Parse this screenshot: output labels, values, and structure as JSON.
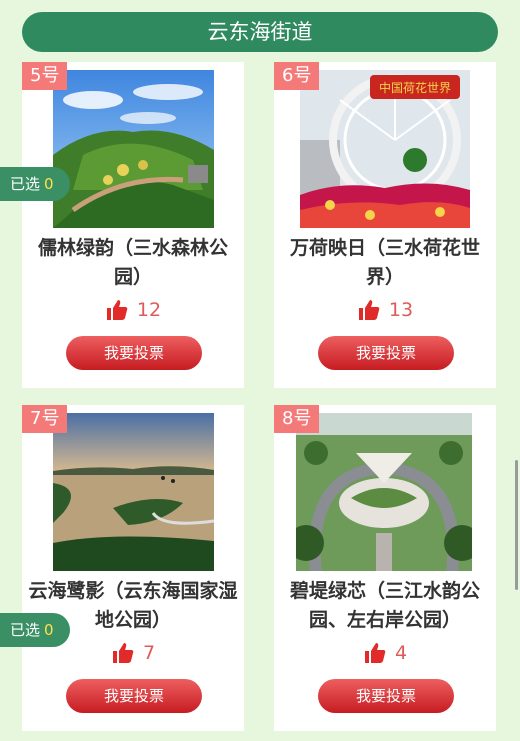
{
  "header": {
    "title": "云东海街道"
  },
  "badge": {
    "label": "已选",
    "count": "0"
  },
  "cards": [
    {
      "tag": "5号",
      "title": "儒林绿韵（三水森林公园）",
      "likes": "12",
      "vote_label": "我要投票"
    },
    {
      "tag": "6号",
      "title": "万荷映日（三水荷花世界）",
      "likes": "13",
      "vote_label": "我要投票",
      "sign_text": "中国荷花世界"
    },
    {
      "tag": "7号",
      "title": "云海鹭影（云东海国家湿地公园）",
      "likes": "7",
      "vote_label": "我要投票"
    },
    {
      "tag": "8号",
      "title": "碧堤绿芯（三江水韵公园、左右岸公园）",
      "likes": "4",
      "vote_label": "我要投票"
    }
  ],
  "colors": {
    "header_bg": "#2f8a5f",
    "tag_bg": "#f47a7a",
    "button": "#d8303a",
    "badge_bg": "#3a8f65",
    "count": "#ffe14d"
  },
  "icons": [
    "thumbs-up-icon"
  ]
}
